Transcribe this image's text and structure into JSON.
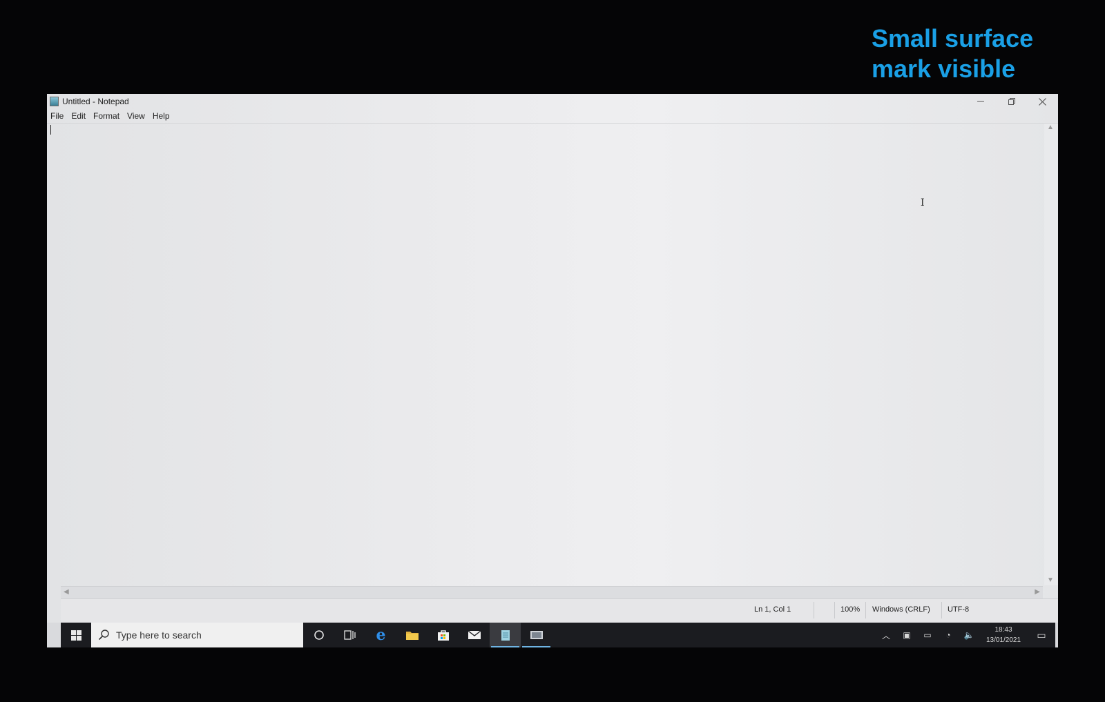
{
  "annotation": {
    "text": "Small surface\nmark visible",
    "color": "#1aa0e6",
    "arrow_icon": "up-arrow-outline"
  },
  "window": {
    "title": "Untitled - Notepad",
    "controls": [
      "minimize",
      "restore",
      "close"
    ]
  },
  "menu": {
    "items": [
      {
        "label": "File"
      },
      {
        "label": "Edit"
      },
      {
        "label": "Format"
      },
      {
        "label": "View"
      },
      {
        "label": "Help"
      }
    ]
  },
  "editor": {
    "content": ""
  },
  "status": {
    "position": "Ln 1, Col 1",
    "zoom": "100%",
    "line_ending": "Windows (CRLF)",
    "encoding": "UTF-8"
  },
  "taskbar": {
    "search_placeholder": "Type here to search",
    "pinned": [
      "cortana",
      "task-view",
      "edge",
      "file-explorer",
      "store",
      "mail",
      "notepad",
      "other-app"
    ],
    "clock_time": "18:43",
    "clock_date": "13/01/2021"
  }
}
